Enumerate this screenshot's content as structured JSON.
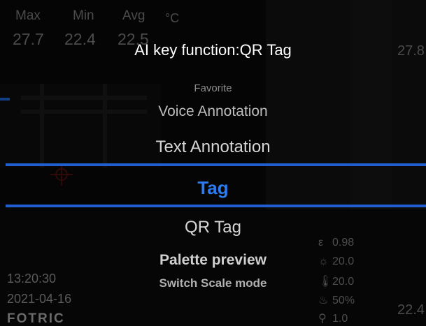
{
  "header": {
    "stats": [
      {
        "label": "Max",
        "value": "27.7"
      },
      {
        "label": "Min",
        "value": "22.4"
      },
      {
        "label": "Avg",
        "value": "22.5"
      }
    ],
    "unit": "°C"
  },
  "right_edge": {
    "top_value": "27.8",
    "bottom_value": "22.4"
  },
  "dialog": {
    "title": "AI key function:QR Tag",
    "items": [
      "Favorite",
      "Voice Annotation",
      "Text Annotation",
      "Tag",
      "QR Tag",
      "Palette preview",
      "Switch Scale mode"
    ],
    "selected_index": 3
  },
  "status": {
    "time": "13:20:30",
    "date": "2021-04-16",
    "logo": "FOTRIC"
  },
  "params": [
    {
      "icon": "emissivity-icon",
      "glyph": "ε",
      "value": "0.98"
    },
    {
      "icon": "ambient-temp-icon",
      "glyph": "☼",
      "value": "20.0"
    },
    {
      "icon": "thermometer-icon",
      "glyph": "🌡",
      "value": "20.0"
    },
    {
      "icon": "humidity-icon",
      "glyph": "♨",
      "value": "50%"
    },
    {
      "icon": "distance-icon",
      "glyph": "⚲",
      "value": "1.0"
    }
  ],
  "colors": {
    "accent": "#1f5fcf",
    "selected_text": "#2a7cf0"
  }
}
